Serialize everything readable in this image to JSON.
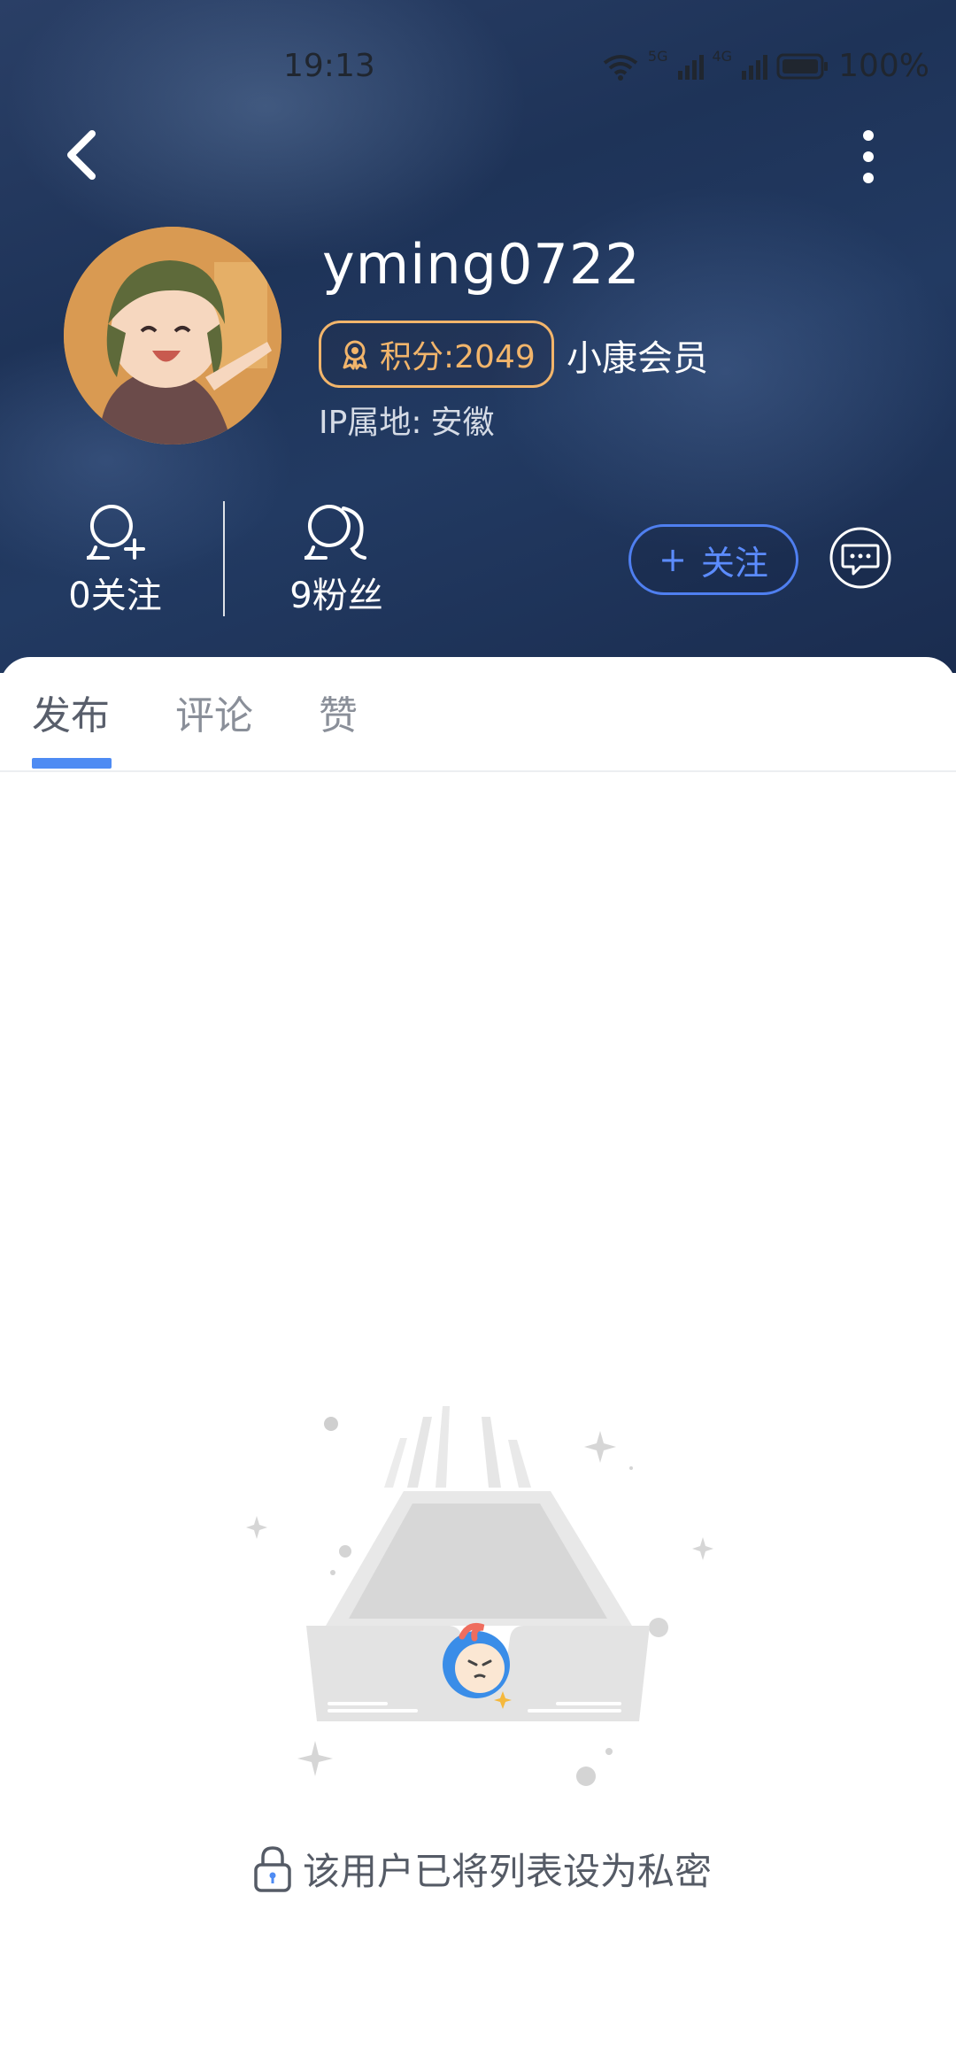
{
  "status_bar": {
    "time": "19:13",
    "network1": "5G",
    "network2": "4G",
    "battery": "100%"
  },
  "profile": {
    "username": "yming0722",
    "points_label": "积分:2049",
    "member_label": "小康会员",
    "ip_label": "IP属地:",
    "ip_value": "安徽"
  },
  "stats": {
    "following": "0关注",
    "followers": "9粉丝"
  },
  "actions": {
    "follow_label": "关注",
    "follow_plus": "+"
  },
  "tabs": [
    {
      "label": "发布"
    },
    {
      "label": "评论"
    },
    {
      "label": "赞"
    }
  ],
  "empty_state": {
    "message": "该用户已将列表设为私密"
  },
  "colors": {
    "accent": "#4e8bf3",
    "points": "#f2b56b"
  },
  "icons": [
    "back-icon",
    "more-icon",
    "wifi-icon",
    "signal-icon",
    "battery-icon",
    "points-icon",
    "follow-icon",
    "fans-icon",
    "message-icon",
    "lock-icon"
  ]
}
